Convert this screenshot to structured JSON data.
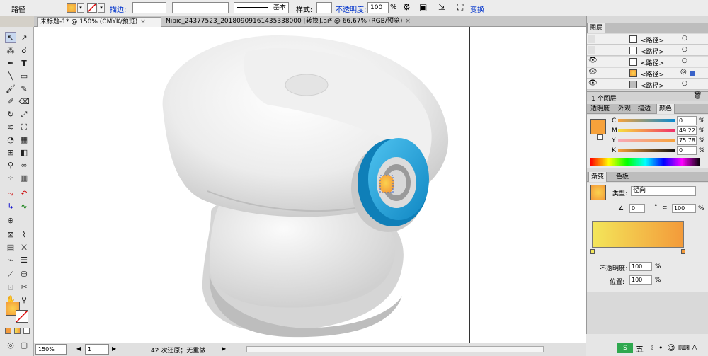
{
  "control_bar": {
    "object_type": "路径",
    "stroke_label": "描边:",
    "stroke_style": "基本",
    "style_label": "样式:",
    "opacity_label": "不透明度:",
    "opacity_value": "100",
    "opacity_unit": "%",
    "transform_label": "变换"
  },
  "tabs": [
    {
      "label": "未标题-1* @ 150% (CMYK/预览)",
      "close": "×"
    },
    {
      "label": "Nipic_24377523_20180909161435338000 [转换].ai* @ 66.67% (RGB/预览)",
      "close": "×"
    }
  ],
  "status": {
    "zoom": "150%",
    "page": "1",
    "history": "42 次还原；无重做"
  },
  "layers": {
    "title": "图层",
    "items": [
      "<路径>",
      "<路径>",
      "<路径>",
      "<路径>",
      "<路径>"
    ],
    "footer": "1 个图层"
  },
  "color_panel": {
    "tabs": [
      "透明度",
      "外观",
      "描边",
      "颜色"
    ],
    "channels": [
      {
        "name": "C",
        "value": "0"
      },
      {
        "name": "M",
        "value": "49.22"
      },
      {
        "name": "Y",
        "value": "75.78"
      },
      {
        "name": "K",
        "value": "0"
      }
    ],
    "unit": "%"
  },
  "gradient_panel": {
    "tabs": [
      "渐变",
      "色板"
    ],
    "type_label": "类型:",
    "type_value": "径向",
    "angle_value": "0",
    "angle_unit": "°",
    "ratio_value": "100",
    "ratio_unit": "%",
    "opacity_label": "不透明度:",
    "opacity_value": "100",
    "position_label": "位置:",
    "position_value": "100",
    "unit": "%"
  },
  "colors": {
    "fill_orange": "#f7a23b",
    "gradient_start": "#f3e65a",
    "gradient_end": "#f39a3a",
    "lens_blue": "#1aa5dd",
    "link_blue": "#0033cc"
  }
}
